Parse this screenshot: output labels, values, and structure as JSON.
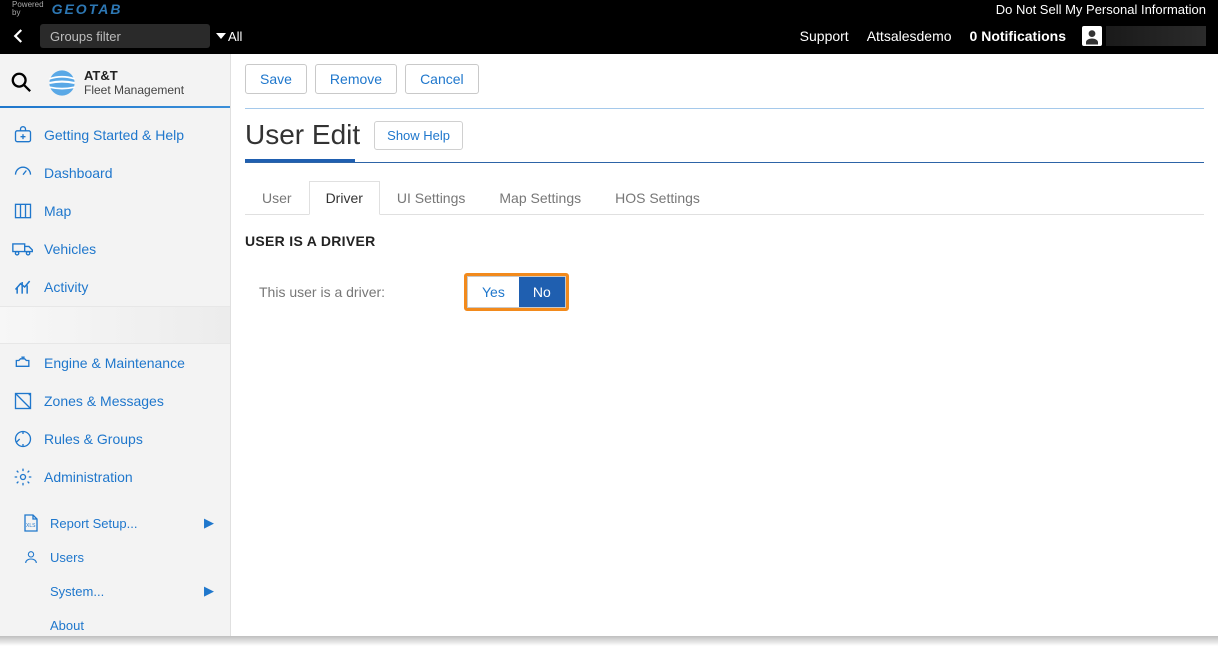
{
  "top": {
    "powered": "Powered",
    "by": "by",
    "geotab": "GEOTAB",
    "dnsmpi": "Do Not Sell My Personal Information"
  },
  "menubar": {
    "groups_filter_placeholder": "Groups filter",
    "all_label": "All",
    "support": "Support",
    "account": "Attsalesdemo",
    "notifications": "0 Notifications"
  },
  "brand": {
    "line1": "AT&T",
    "line2": "Fleet Management"
  },
  "sidebar": {
    "items": [
      {
        "label": "Getting Started & Help"
      },
      {
        "label": "Dashboard"
      },
      {
        "label": "Map"
      },
      {
        "label": "Vehicles"
      },
      {
        "label": "Activity"
      },
      {
        "label": ""
      },
      {
        "label": "Engine & Maintenance"
      },
      {
        "label": "Zones & Messages"
      },
      {
        "label": "Rules & Groups"
      },
      {
        "label": "Administration"
      }
    ],
    "sub": {
      "report_setup": "Report Setup...",
      "users": "Users",
      "system": "System...",
      "about": "About"
    }
  },
  "actions": {
    "save": "Save",
    "remove": "Remove",
    "cancel": "Cancel"
  },
  "page": {
    "title": "User Edit",
    "show_help": "Show Help"
  },
  "tabs": {
    "user": "User",
    "driver": "Driver",
    "ui": "UI Settings",
    "map": "Map Settings",
    "hos": "HOS Settings"
  },
  "section": {
    "heading": "USER IS A DRIVER",
    "field_label": "This user is a driver:",
    "yes": "Yes",
    "no": "No"
  }
}
